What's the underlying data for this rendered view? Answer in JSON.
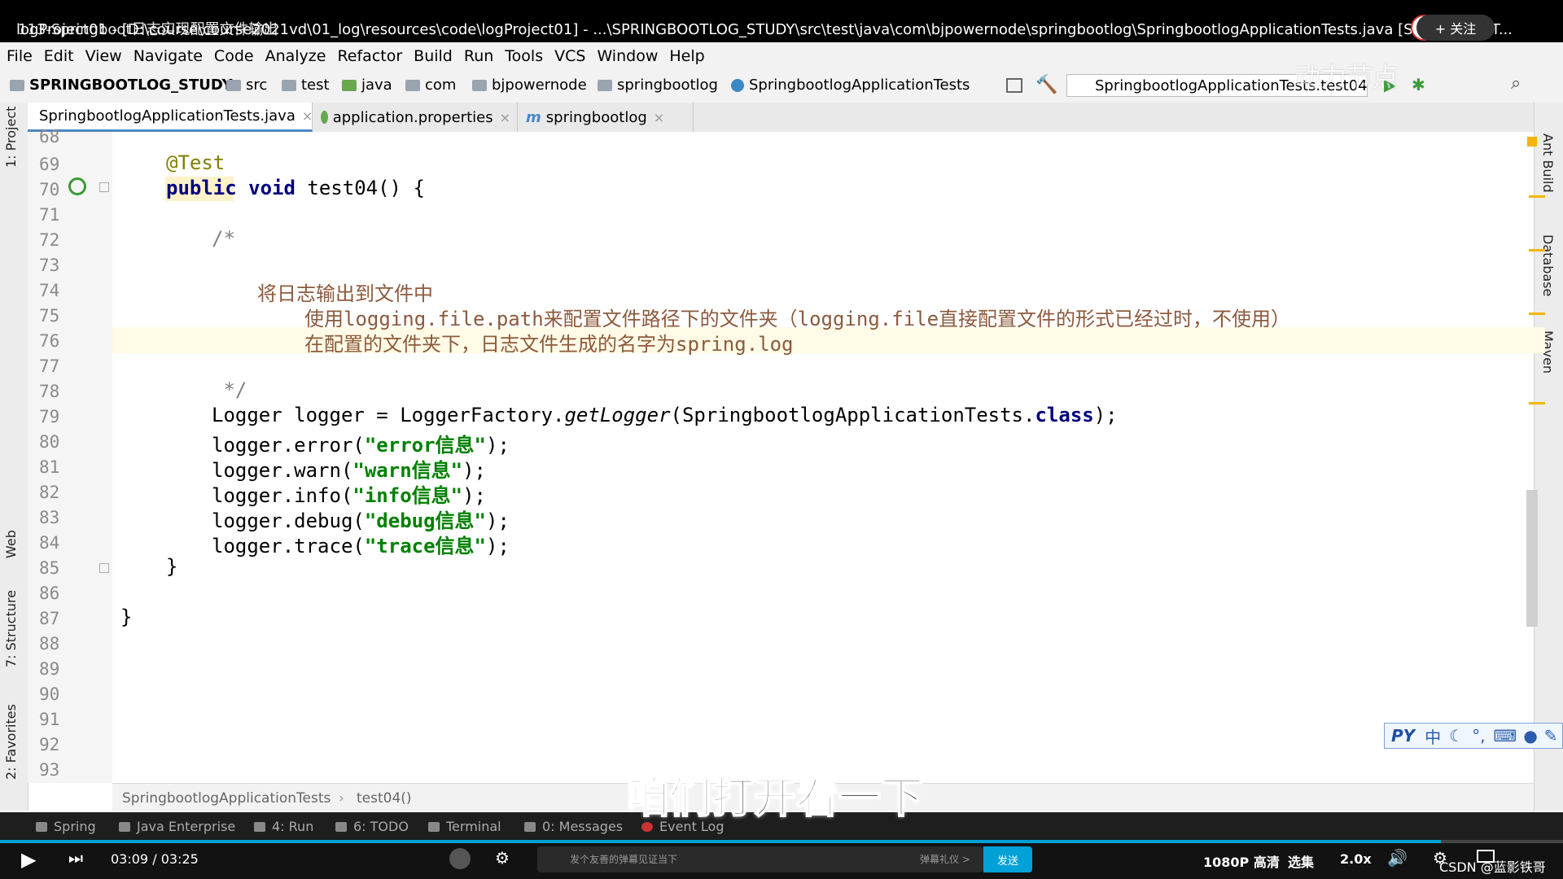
{
  "title_bar": {
    "title": "logProject01 - [D:\\course\\course2021vd\\01_log\\resources\\code\\logProject01] - ...\\SPRINGBOOTLOG_STUDY\\src\\test\\java\\com\\bjpowernode\\springbootlog\\SpringbootlogApplicationTests.java [SPRINGBOOT...",
    "video_title": "113-Springboot日志实现配置文件输出",
    "follow_label": "+ 关注"
  },
  "menu": [
    "File",
    "Edit",
    "View",
    "Navigate",
    "Code",
    "Analyze",
    "Refactor",
    "Build",
    "Run",
    "Tools",
    "VCS",
    "Window",
    "Help"
  ],
  "breadcrumb": {
    "project": "SPRINGBOOTLOG_STUDY",
    "items": [
      "src",
      "test",
      "java",
      "com",
      "bjpowernode",
      "springbootlog"
    ],
    "class": "SpringbootlogApplicationTests"
  },
  "run_config": "SpringbootlogApplicationTests.test04",
  "tabs": [
    {
      "label": "SpringbootlogApplicationTests.java",
      "active": true
    },
    {
      "label": "application.properties",
      "active": false
    },
    {
      "label": "springbootlog",
      "active": false
    }
  ],
  "left_tools": [
    "1: Project",
    "Web",
    "7: Structure",
    "2: Favorites"
  ],
  "right_tools": [
    "Ant Build",
    "Database",
    "Maven"
  ],
  "line_numbers": [
    "68",
    "69",
    "70",
    "71",
    "72",
    "73",
    "74",
    "75",
    "76",
    "77",
    "78",
    "79",
    "80",
    "81",
    "82",
    "83",
    "84",
    "85",
    "86",
    "87",
    "88",
    "89",
    "90",
    "91",
    "92",
    "93"
  ],
  "code": {
    "l69": "@Test",
    "l70_kw1": "public",
    "l70_kw2": "void",
    "l70_rest": " test04() {",
    "l72": "/*",
    "l74": "将日志输出到文件中",
    "l75_a": "使用",
    "l75_b": "logging.file.path",
    "l75_c": "来配置文件路径下的文件夹（",
    "l75_d": "logging.file",
    "l75_e": "直接配置文件的形式已经过时，不使用）",
    "l76_a": "在配置的文件夹下，日志文件生成的名字为",
    "l76_b": "spring.log",
    "l78": " */",
    "l79_a": "Logger logger = LoggerFactory.",
    "l79_b": "getLogger",
    "l79_c": "(SpringbootlogApplicationTests.",
    "l79_d": "class",
    "l79_e": ");",
    "l80_a": "logger.error(",
    "l80_s": "\"error信息\"",
    "l81_a": "logger.warn(",
    "l81_s": "\"warn信息\"",
    "l82_a": "logger.info(",
    "l82_s": "\"info信息\"",
    "l83_a": "logger.debug(",
    "l83_s": "\"debug信息\"",
    "l84_a": "logger.trace(",
    "l84_s": "\"trace信息\"",
    "close": ");",
    "l85": "}",
    "l87": "}"
  },
  "bottom_breadcrumb": {
    "class": "SpringbootlogApplicationTests",
    "method": "test04()"
  },
  "tool_windows": [
    "Spring",
    "Java Enterprise",
    "4: Run",
    "6: TODO",
    "Terminal",
    "0: Messages",
    "Event Log"
  ],
  "player": {
    "current_time": "03:09",
    "total_time": "03:25",
    "time_separator": "/",
    "progress": 0.922,
    "danmaku_placeholder": "发个友善的弹幕见证当下",
    "danmaku_etiquette": "弹幕礼仪 >",
    "send_label": "发送",
    "quality": "1080P 高清",
    "episodes": "选集",
    "speed": "2.0x"
  },
  "subtitle": "咱们打开看一下",
  "watermark": "动力节点",
  "ime": {
    "label": "中"
  },
  "csdn": "CSDN @蓝影铁哥",
  "colors": {
    "keyword": "#000080",
    "string": "#008000",
    "annotation": "#808000",
    "comment": "#808080",
    "accent": "#00a1d6"
  }
}
